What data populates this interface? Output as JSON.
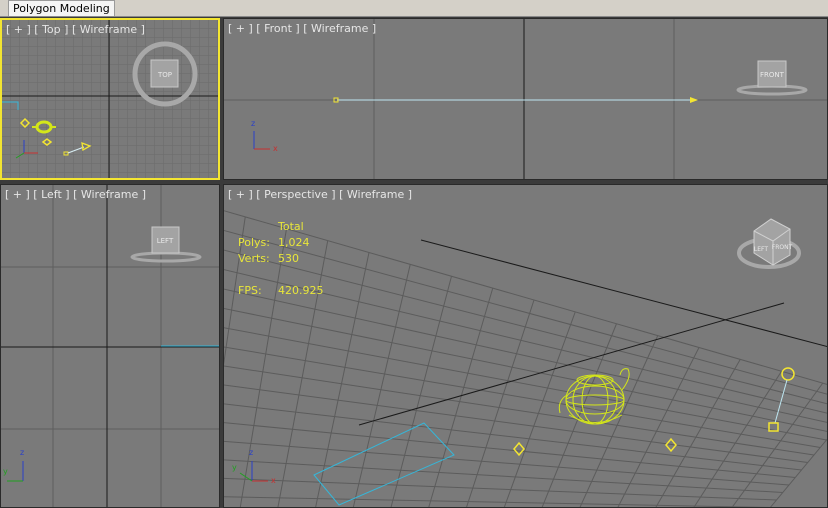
{
  "ribbon": {
    "active_tab": "Polygon Modeling"
  },
  "viewports": {
    "top": {
      "plus": "[ + ]",
      "name": "[ Top ]",
      "mode": "[ Wireframe ]",
      "viewcube": "TOP"
    },
    "front": {
      "plus": "[ + ]",
      "name": "[ Front ]",
      "mode": "[ Wireframe ]",
      "viewcube": "FRONT"
    },
    "left": {
      "plus": "[ + ]",
      "name": "[ Left ]",
      "mode": "[ Wireframe ]",
      "viewcube": "LEFT"
    },
    "perspective": {
      "plus": "[ + ]",
      "name": "[ Perspective ]",
      "mode": "[ Wireframe ]",
      "viewcube_left": "LEFT",
      "viewcube_front": "FRONT"
    }
  },
  "stats": {
    "header": "Total",
    "polys_label": "Polys:",
    "polys": "1,024",
    "verts_label": "Verts:",
    "verts": "530",
    "fps_label": "FPS:",
    "fps": "420.925"
  },
  "axis": {
    "x": "x",
    "y": "y",
    "z": "z"
  },
  "colors": {
    "viewport_bg": "#7a7a7a",
    "grid": "#666666",
    "active_border": "#f3e531",
    "selection": "#d4e619",
    "helper": "#f3e531",
    "shape": "#36b6d8"
  }
}
